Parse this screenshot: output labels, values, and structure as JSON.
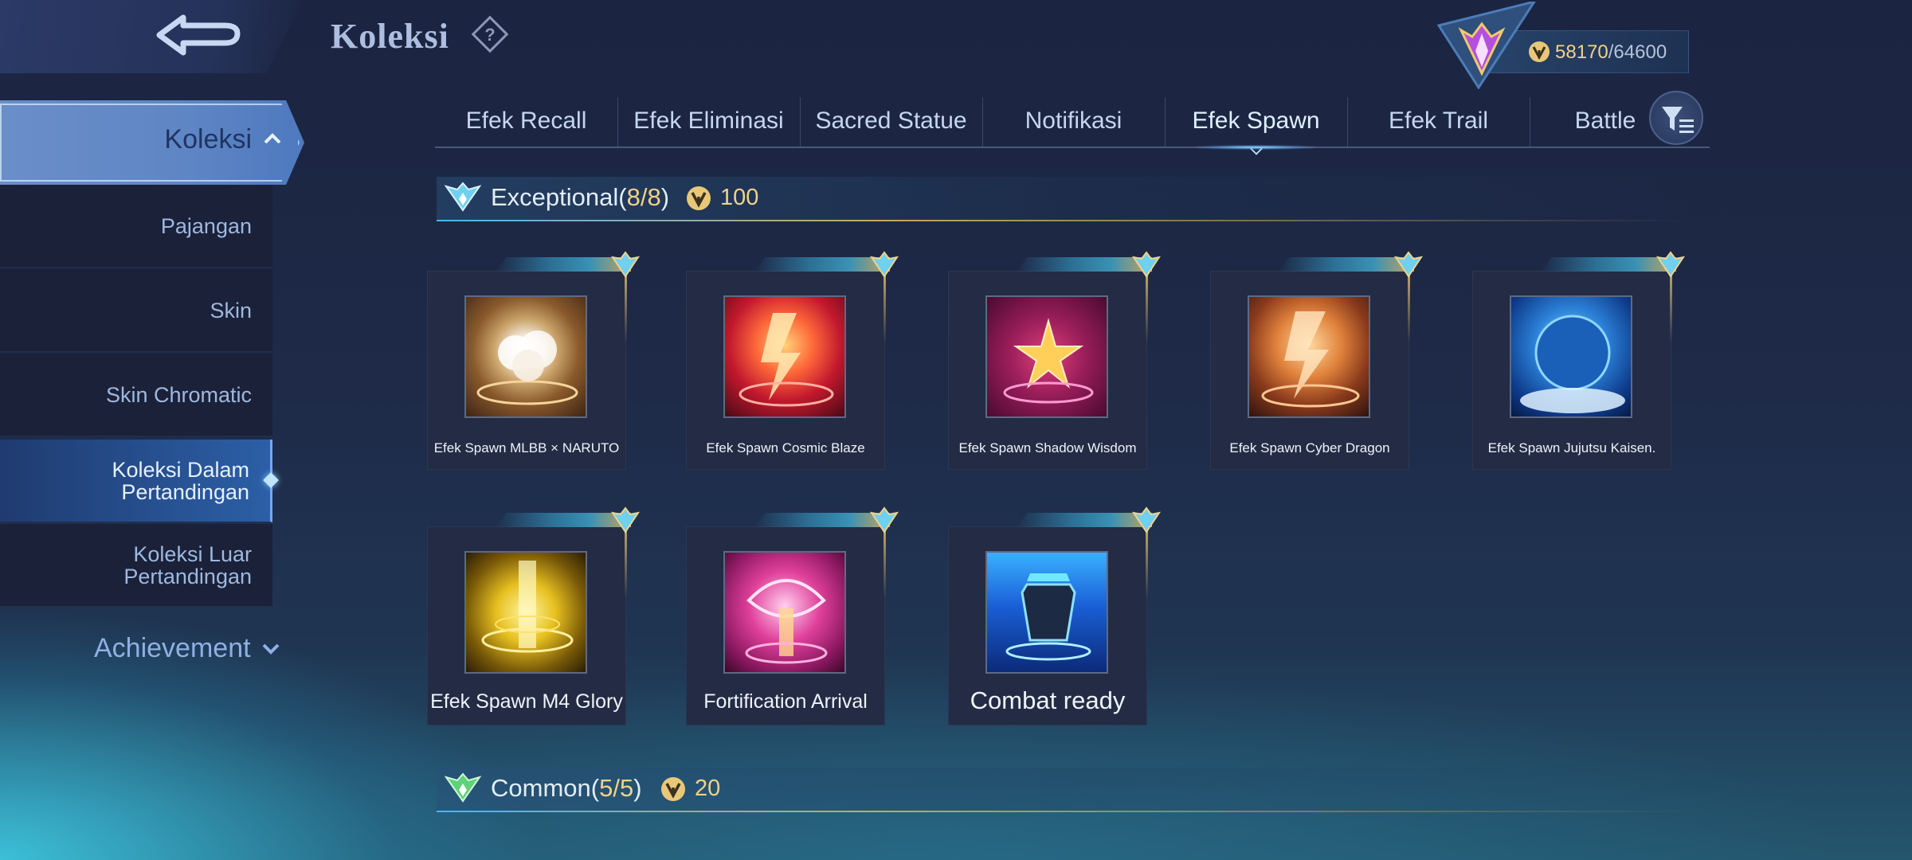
{
  "header": {
    "title": "Koleksi",
    "back_icon": "back-arrow-icon",
    "help_icon": "question-icon",
    "currency": {
      "current": "58170",
      "separator": "/",
      "max": "64600"
    }
  },
  "sidebar": {
    "active": {
      "label": "Koleksi"
    },
    "items": [
      {
        "label": "Pajangan"
      },
      {
        "label": "Skin"
      },
      {
        "label": "Skin Chromatic"
      },
      {
        "label": "Koleksi Dalam Pertandingan"
      },
      {
        "label": "Koleksi Luar Pertandingan"
      }
    ],
    "achievement": "Achievement"
  },
  "tabs": [
    {
      "label": "Efek Recall"
    },
    {
      "label": "Efek Eliminasi"
    },
    {
      "label": "Sacred Statue"
    },
    {
      "label": "Notifikasi"
    },
    {
      "label": "Efek Spawn"
    },
    {
      "label": "Efek Trail"
    },
    {
      "label": "Battle"
    }
  ],
  "active_tab": "Efek Spawn",
  "sections": {
    "exceptional": {
      "name": "Exceptional",
      "open": "(",
      "count": "8/8",
      "close": ")",
      "points": "100"
    },
    "common": {
      "name": "Common",
      "open": "(",
      "count": "5/5",
      "close": ")",
      "points": "20"
    }
  },
  "cards": [
    {
      "name": "Efek Spawn MLBB × NARUTO"
    },
    {
      "name": "Efek Spawn Cosmic Blaze"
    },
    {
      "name": "Efek Spawn Shadow Wisdom"
    },
    {
      "name": "Efek Spawn Cyber Dragon"
    },
    {
      "name": "Efek Spawn Jujutsu Kaisen."
    },
    {
      "name": "Efek Spawn M4 Glory"
    },
    {
      "name": "Fortification Arrival"
    },
    {
      "name": "Combat ready"
    }
  ],
  "colors": {
    "accent_gold": "#f0d28a",
    "tab_active": "#8fd6ff",
    "sidebar_active": "#6a8ec8"
  }
}
